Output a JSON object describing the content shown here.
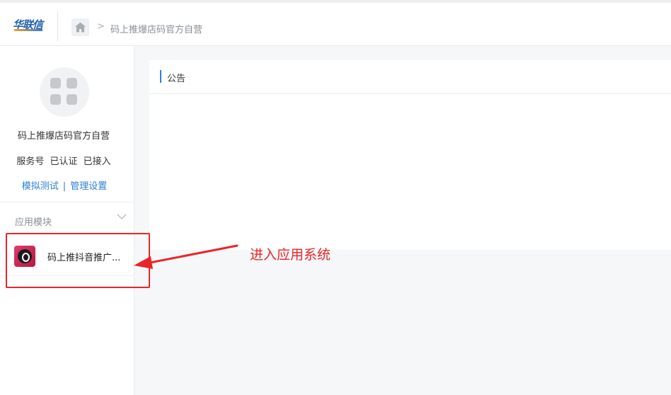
{
  "header": {
    "logo_text": "华联信",
    "breadcrumb_separator": ">",
    "breadcrumb_current": "码上推爆店码官方自营"
  },
  "sidebar": {
    "account_name": "码上推爆店码官方自营",
    "account_type": "服务号",
    "verified": "已认证",
    "connected": "已接入",
    "link_test": "模拟测试",
    "link_separator": "|",
    "link_settings": "管理设置",
    "modules_title": "应用模块",
    "modules": [
      {
        "name": "码上推抖音推广..."
      }
    ]
  },
  "panel": {
    "title": "公告"
  },
  "annotation": {
    "callout_text": "进入应用系统",
    "color": "#e8262a"
  },
  "colors": {
    "accent": "#2d7fd8",
    "annotation": "#e8262a",
    "background": "#f6f7f9"
  },
  "icons": {
    "home": "home-icon",
    "chevron": "chevron-down-icon",
    "app": "douyin-app-icon"
  }
}
